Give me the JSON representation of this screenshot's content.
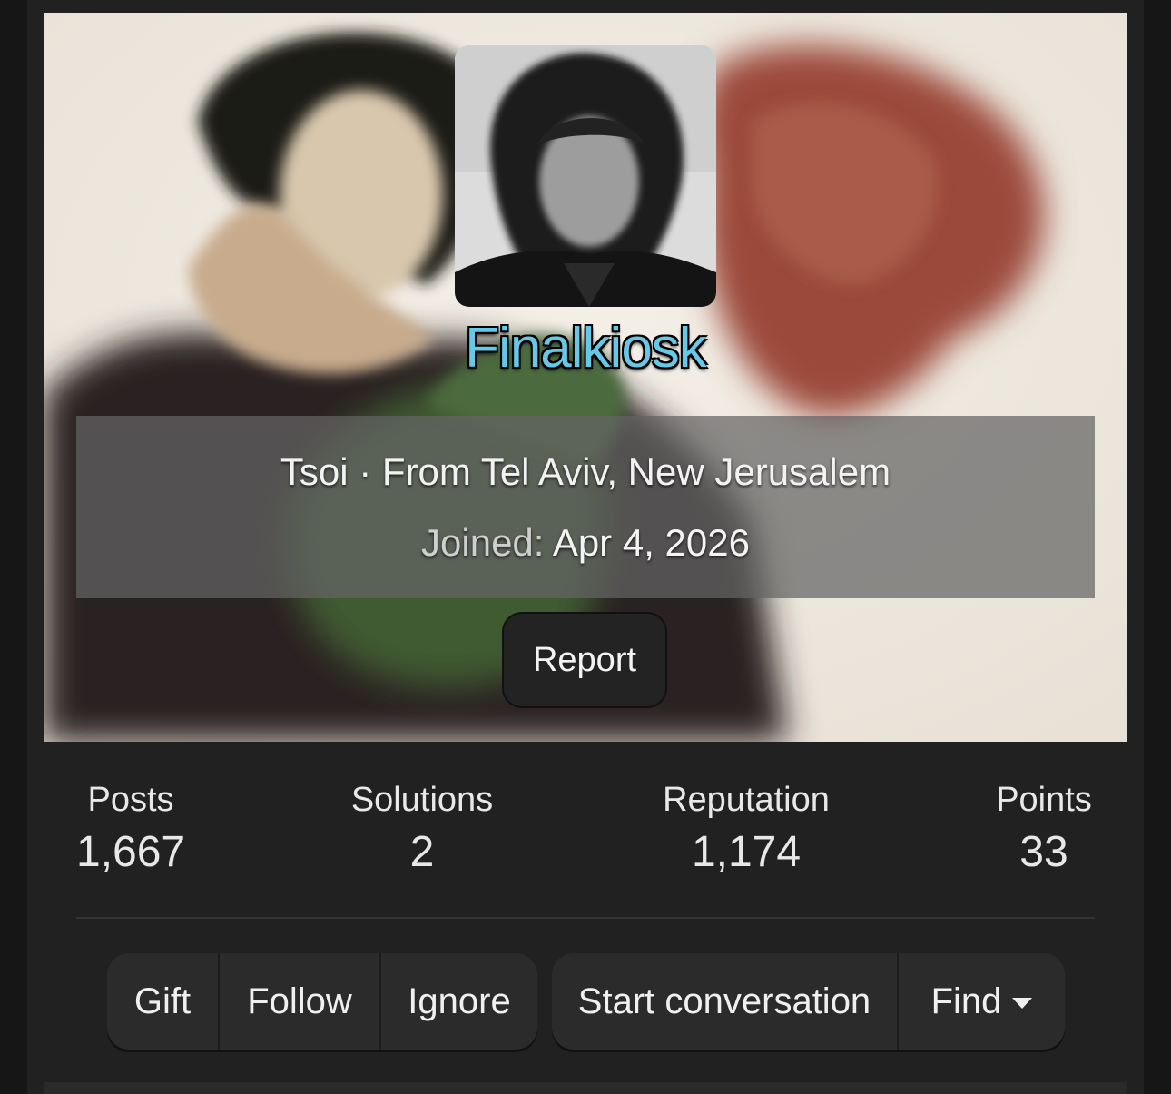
{
  "profile": {
    "username": "Finalkiosk",
    "title_location": "Tsoi · From Tel Aviv, New Jerusalem",
    "joined_label": "Joined:",
    "joined_value": "Apr 4, 2026",
    "report_label": "Report",
    "username_color": "#67c7e6"
  },
  "stats": [
    {
      "label": "Posts",
      "value": "1,667"
    },
    {
      "label": "Solutions",
      "value": "2"
    },
    {
      "label": "Reputation",
      "value": "1,174"
    },
    {
      "label": "Points",
      "value": "33"
    }
  ],
  "actions": {
    "gift": "Gift",
    "follow": "Follow",
    "ignore": "Ignore",
    "start_conversation": "Start conversation",
    "find": "Find"
  },
  "icons": {
    "find_dropdown": "caret-down-icon"
  }
}
